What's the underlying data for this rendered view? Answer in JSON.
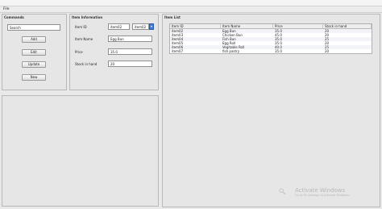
{
  "menu": {
    "file_label": "File"
  },
  "commands": {
    "title": "Commands",
    "search_value": "Search",
    "buttons": {
      "add": "Add",
      "edit": "Edit",
      "update": "Update",
      "new": "New"
    }
  },
  "item_info": {
    "title": "Item Information",
    "labels": {
      "item_id": "Item ID",
      "item_name": "Item Name",
      "price": "Price",
      "stock": "Stock in hand"
    },
    "values": {
      "item_id": "item02",
      "item_id_combo": "item02",
      "item_name": "Egg Bun",
      "price": "35.0",
      "stock": "20"
    }
  },
  "item_list": {
    "title": "Item List",
    "columns": [
      "Item ID",
      "Item Name",
      "Price",
      "Stock in hand"
    ],
    "rows": [
      [
        "item02",
        "Egg Bun",
        "35.0",
        "20"
      ],
      [
        "item03",
        "Chicken Bun",
        "45.0",
        "20"
      ],
      [
        "item04",
        "Fish Bun",
        "35.0",
        "25"
      ],
      [
        "item05",
        "Egg Roll",
        "35.0",
        "20"
      ],
      [
        "item06",
        "Vegitable Roll",
        "40.0",
        "25"
      ],
      [
        "item07",
        "fish pastry",
        "35.0",
        "20"
      ]
    ]
  },
  "watermark": {
    "title": "Activate Windows",
    "subtitle": "Go to PC settings to activate Windows."
  }
}
